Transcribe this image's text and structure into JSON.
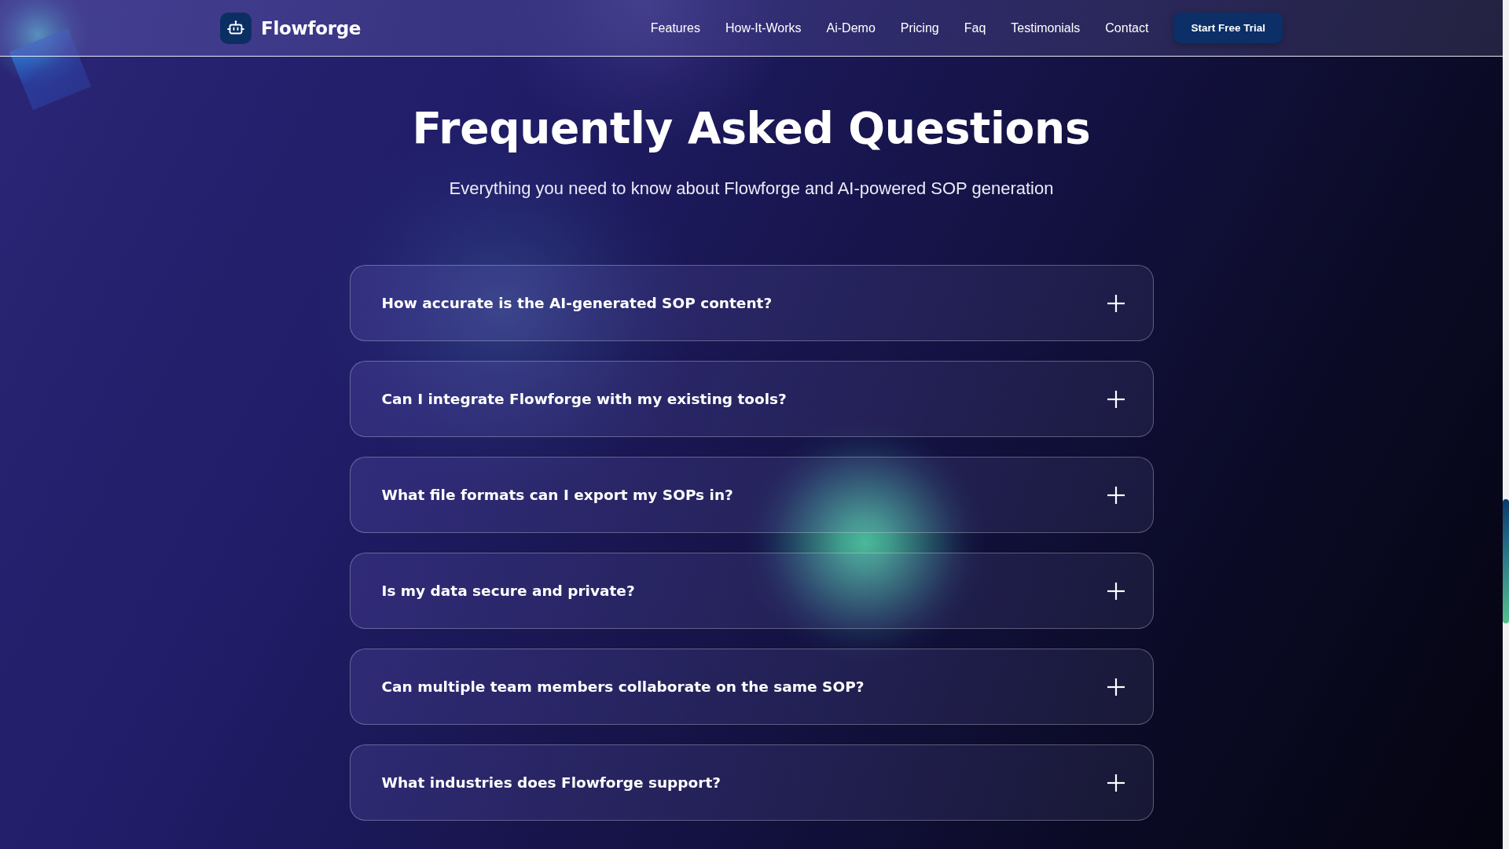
{
  "header": {
    "brand": "Flowforge",
    "nav": [
      "Features",
      "How-It-Works",
      "Ai-Demo",
      "Pricing",
      "Faq",
      "Testimonials",
      "Contact"
    ],
    "cta": "Start Free Trial"
  },
  "faq": {
    "title": "Frequently Asked Questions",
    "subtitle": "Everything you need to know about Flowforge and AI-powered SOP generation",
    "items": [
      {
        "question": "How accurate is the AI-generated SOP content?",
        "expanded": false
      },
      {
        "question": "Can I integrate Flowforge with my existing tools?",
        "expanded": false
      },
      {
        "question": "What file formats can I export my SOPs in?",
        "expanded": false
      },
      {
        "question": "Is my data secure and private?",
        "expanded": false
      },
      {
        "question": "Can multiple team members collaborate on the same SOP?",
        "expanded": false
      },
      {
        "question": "What industries does Flowforge support?",
        "expanded": false
      }
    ]
  }
}
